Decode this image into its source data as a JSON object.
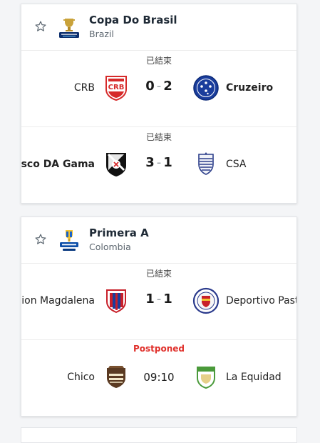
{
  "leagues": [
    {
      "name": "Copa Do Brasil",
      "country": "Brazil",
      "logo_icon": "copa-do-brasil-logo",
      "matches": [
        {
          "status": "已結束",
          "home": "CRB",
          "away": "Cruzeiro",
          "home_score": "0",
          "away_score": "2",
          "winner": "away"
        },
        {
          "status": "已結束",
          "home": "Vasco DA Gama",
          "away": "CSA",
          "home_score": "3",
          "away_score": "1",
          "winner": "home"
        }
      ]
    },
    {
      "name": "Primera A",
      "country": "Colombia",
      "logo_icon": "betplay-liga-logo",
      "matches": [
        {
          "status": "已結束",
          "home": "Union Magdalena",
          "away": "Deportivo Pasto",
          "home_score": "1",
          "away_score": "1",
          "winner": "none"
        },
        {
          "status": "Postponed",
          "home": "Chico",
          "away": "La Equidad",
          "time": "09:10"
        }
      ]
    }
  ],
  "colors": {
    "postponed": "#e0302b",
    "accent_dark": "#1f2a36"
  }
}
